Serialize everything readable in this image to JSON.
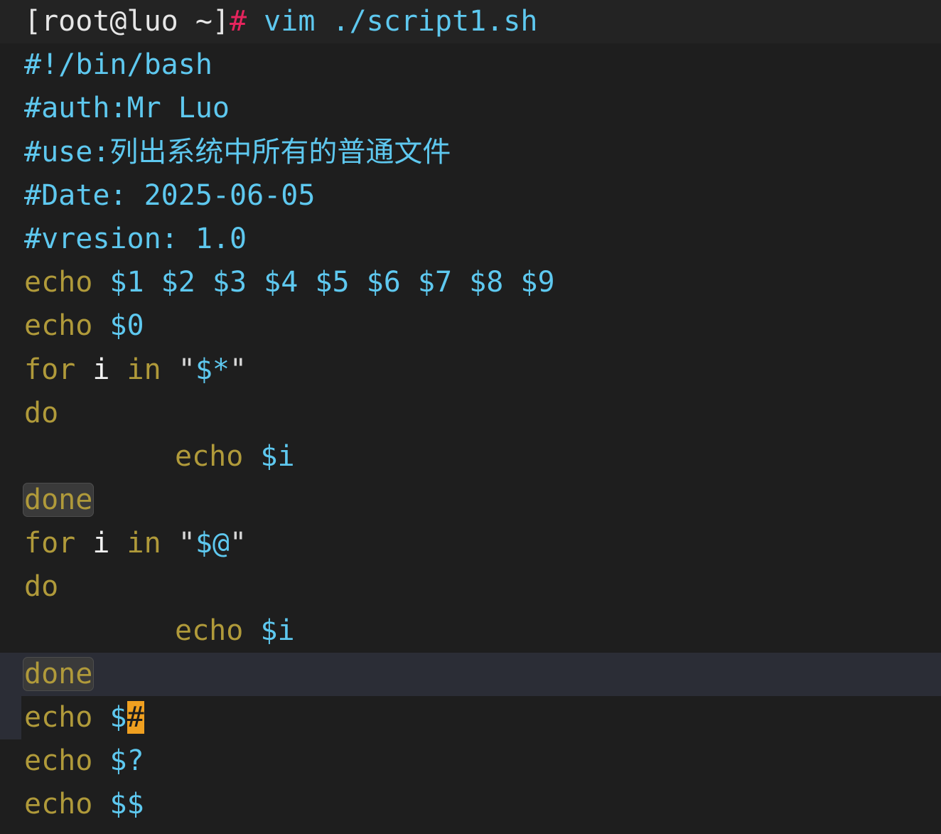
{
  "prompt": {
    "user_host": "[root@luo ~]",
    "symbol": "#",
    "command": " vim ./script1.sh"
  },
  "colors": {
    "background": "#1e1e1e",
    "comment": "#5ec8ef",
    "keyword": "#b09a3a",
    "variable": "#5ec8ef",
    "prompt_symbol": "#e5245d",
    "cursor": "#f0a020",
    "cursorline": "#2b2d36"
  },
  "script": {
    "l1": "#!/bin/bash",
    "l2": "#auth:Mr Luo",
    "l3": "#use:列出系统中所有的普通文件",
    "l4": "#Date: 2025-06-05",
    "l5": "#vresion: 1.0",
    "l6_kw": "echo",
    "l6_args": " $1 $2 $3 $4 $5 $6 $7 $8 $9",
    "l7_kw": "echo",
    "l7_args": " $0",
    "l8_for": "for",
    "l8_var": " i ",
    "l8_in": "in",
    "l8_q1": " \"",
    "l8_arg": "$*",
    "l8_q2": "\"",
    "l9": "do",
    "l10_kw": "echo",
    "l10_arg": " $i",
    "l11": "done",
    "l12_for": "for",
    "l12_var": " i ",
    "l12_in": "in",
    "l12_q1": " \"",
    "l12_arg": "$@",
    "l12_q2": "\"",
    "l13": "do",
    "l14_kw": "echo",
    "l14_arg": " $i",
    "l15": "done",
    "l16_kw": "echo",
    "l16_dollar": " $",
    "l16_cursor": "#",
    "l17_kw": "echo",
    "l17_arg": " $?",
    "l18_kw": "echo",
    "l18_arg": " $$"
  }
}
